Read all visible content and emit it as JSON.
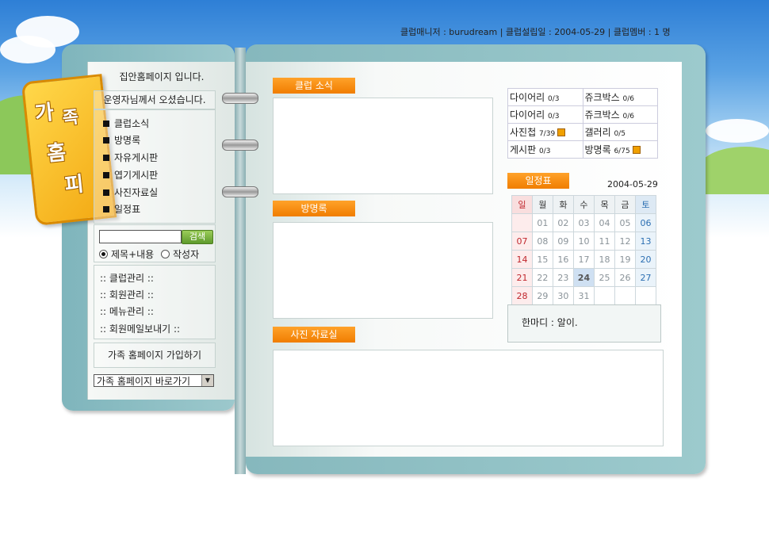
{
  "header": {
    "info": "클럽매니저 : burudream  |  클럽설립일 : 2004-05-29  |  클럽멤버 : 1 명"
  },
  "tab": {
    "chars": [
      "가",
      "족",
      "홈",
      "피"
    ]
  },
  "left": {
    "welcome": "집안홈페이지 입니다.",
    "operator": "운영자님께서 오셨습니다.",
    "menu": [
      "클럽소식",
      "방명록",
      "자유게시판",
      "엽기게시판",
      "사진자료실",
      "일정표"
    ],
    "search": {
      "button": "검색",
      "option1": "제목+내용",
      "option2": "작성자",
      "value": ""
    },
    "admin": [
      ":: 클럽관리 ::",
      ":: 회원관리 ::",
      ":: 메뉴관리 ::",
      ":: 회원메일보내기 ::"
    ],
    "join": "가족 홈페이지 가입하기",
    "goto_select": "가족 홈페이지 바로가기"
  },
  "main": {
    "news_label": "클럽 소식",
    "guestbook_label": "방명록",
    "photo_label": "사진 자료실"
  },
  "stats": [
    [
      {
        "name": "다이어리",
        "count": "0/3"
      },
      {
        "name": "쥬크박스",
        "count": "0/6"
      }
    ],
    [
      {
        "name": "다이어리",
        "count": "0/3"
      },
      {
        "name": "쥬크박스",
        "count": "0/6"
      }
    ],
    [
      {
        "name": "사진첩",
        "count": "7/39",
        "new": true
      },
      {
        "name": "갤러리",
        "count": "0/5"
      }
    ],
    [
      {
        "name": "게시판",
        "count": "0/3"
      },
      {
        "name": "방명록",
        "count": "6/75",
        "new": true
      }
    ]
  ],
  "calendar": {
    "label": "일정표",
    "date": "2004-05-29",
    "weekdays": [
      "일",
      "월",
      "화",
      "수",
      "목",
      "금",
      "토"
    ],
    "weeks": [
      [
        "",
        "01",
        "02",
        "03",
        "04",
        "05",
        "06"
      ],
      [
        "07",
        "08",
        "09",
        "10",
        "11",
        "12",
        "13"
      ],
      [
        "14",
        "15",
        "16",
        "17",
        "18",
        "19",
        "20"
      ],
      [
        "21",
        "22",
        "23",
        "24",
        "25",
        "26",
        "27"
      ],
      [
        "28",
        "29",
        "30",
        "31",
        "",
        "",
        ""
      ]
    ],
    "today": "24"
  },
  "comment": {
    "text": "한마디 : 알이."
  },
  "colors": {
    "accent": "#f58a0a",
    "cover": "#8fbec2"
  }
}
